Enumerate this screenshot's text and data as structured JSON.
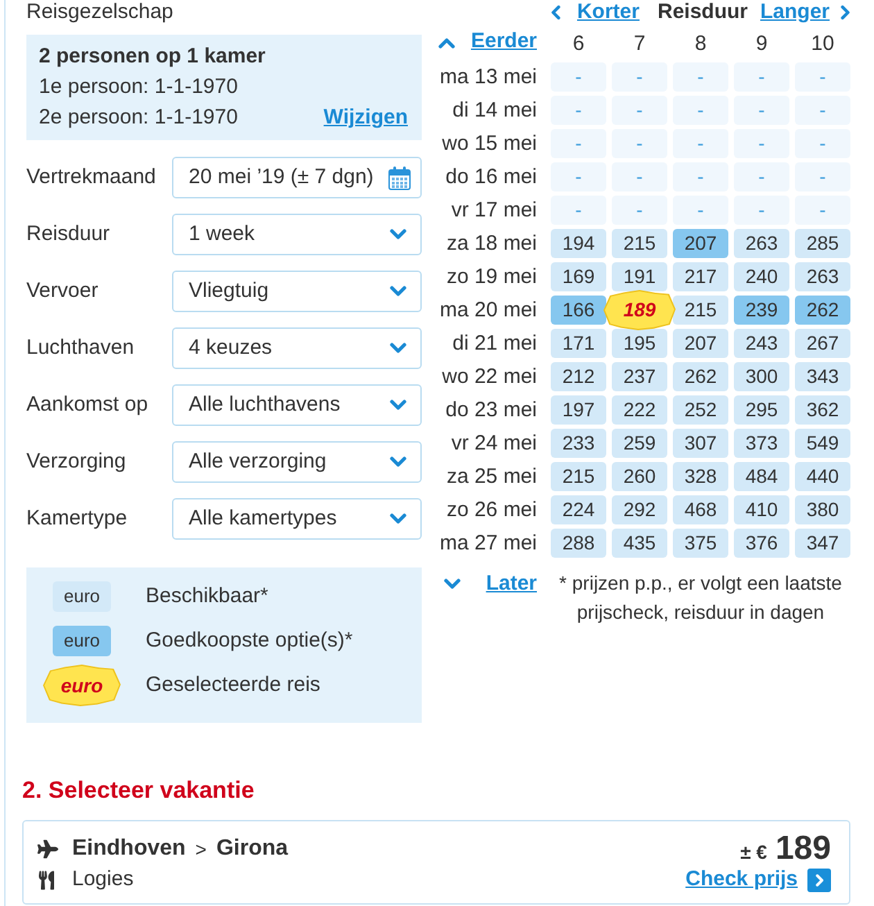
{
  "travel_party": {
    "label": "Reisgezelschap",
    "summary": "2 personen op 1 kamer",
    "persons": [
      "1e persoon: 1-1-1970",
      "2e persoon: 1-1-1970"
    ],
    "change_link": "Wijzigen"
  },
  "fields": [
    {
      "label": "Vertrekmaand",
      "value": "20 mei ’19 (± 7 dgn)",
      "kind": "date"
    },
    {
      "label": "Reisduur",
      "value": "1 week",
      "kind": "select"
    },
    {
      "label": "Vervoer",
      "value": "Vliegtuig",
      "kind": "select"
    },
    {
      "label": "Luchthaven",
      "value": "4 keuzes",
      "kind": "select"
    },
    {
      "label": "Aankomst op",
      "value": "Alle luchthavens",
      "kind": "select"
    },
    {
      "label": "Verzorging",
      "value": "Alle verzorging",
      "kind": "select"
    },
    {
      "label": "Kamertype",
      "value": "Alle kamertypes",
      "kind": "select"
    }
  ],
  "legend": [
    {
      "sample": "euro",
      "label": "Beschikbaar*",
      "kind": "available"
    },
    {
      "sample": "euro",
      "label": "Goedkoopste optie(s)*",
      "kind": "cheapest"
    },
    {
      "sample": "euro",
      "label": "Geselecteerde reis",
      "kind": "selected"
    }
  ],
  "duration_nav": {
    "shorter": "Korter",
    "title": "Reisduur",
    "longer": "Langer"
  },
  "price_grid": {
    "earlier": "Eerder",
    "columns": [
      "6",
      "7",
      "8",
      "9",
      "10"
    ],
    "rows": [
      {
        "date": "ma 13 mei",
        "cells": [
          {
            "price": "-",
            "kind": "empty",
            "selected": false
          },
          {
            "price": "-",
            "kind": "empty",
            "selected": false
          },
          {
            "price": "-",
            "kind": "empty",
            "selected": false
          },
          {
            "price": "-",
            "kind": "empty",
            "selected": false
          },
          {
            "price": "-",
            "kind": "empty",
            "selected": false
          }
        ]
      },
      {
        "date": "di 14 mei",
        "cells": [
          {
            "price": "-",
            "kind": "empty",
            "selected": false
          },
          {
            "price": "-",
            "kind": "empty",
            "selected": false
          },
          {
            "price": "-",
            "kind": "empty",
            "selected": false
          },
          {
            "price": "-",
            "kind": "empty",
            "selected": false
          },
          {
            "price": "-",
            "kind": "empty",
            "selected": false
          }
        ]
      },
      {
        "date": "wo 15 mei",
        "cells": [
          {
            "price": "-",
            "kind": "empty",
            "selected": false
          },
          {
            "price": "-",
            "kind": "empty",
            "selected": false
          },
          {
            "price": "-",
            "kind": "empty",
            "selected": false
          },
          {
            "price": "-",
            "kind": "empty",
            "selected": false
          },
          {
            "price": "-",
            "kind": "empty",
            "selected": false
          }
        ]
      },
      {
        "date": "do 16 mei",
        "cells": [
          {
            "price": "-",
            "kind": "empty",
            "selected": false
          },
          {
            "price": "-",
            "kind": "empty",
            "selected": false
          },
          {
            "price": "-",
            "kind": "empty",
            "selected": false
          },
          {
            "price": "-",
            "kind": "empty",
            "selected": false
          },
          {
            "price": "-",
            "kind": "empty",
            "selected": false
          }
        ]
      },
      {
        "date": "vr 17 mei",
        "cells": [
          {
            "price": "-",
            "kind": "empty",
            "selected": false
          },
          {
            "price": "-",
            "kind": "empty",
            "selected": false
          },
          {
            "price": "-",
            "kind": "empty",
            "selected": false
          },
          {
            "price": "-",
            "kind": "empty",
            "selected": false
          },
          {
            "price": "-",
            "kind": "empty",
            "selected": false
          }
        ]
      },
      {
        "date": "za 18 mei",
        "cells": [
          {
            "price": "194",
            "kind": "available",
            "selected": false
          },
          {
            "price": "215",
            "kind": "available",
            "selected": false
          },
          {
            "price": "207",
            "kind": "cheapest",
            "selected": false
          },
          {
            "price": "263",
            "kind": "available",
            "selected": false
          },
          {
            "price": "285",
            "kind": "available",
            "selected": false
          }
        ]
      },
      {
        "date": "zo 19 mei",
        "cells": [
          {
            "price": "169",
            "kind": "available",
            "selected": false
          },
          {
            "price": "191",
            "kind": "available",
            "selected": false
          },
          {
            "price": "217",
            "kind": "available",
            "selected": false
          },
          {
            "price": "240",
            "kind": "available",
            "selected": false
          },
          {
            "price": "263",
            "kind": "available",
            "selected": false
          }
        ]
      },
      {
        "date": "ma 20 mei",
        "cells": [
          {
            "price": "166",
            "kind": "cheapest",
            "selected": false
          },
          {
            "price": "189",
            "selected": true
          },
          {
            "price": "215",
            "kind": "available",
            "selected": false
          },
          {
            "price": "239",
            "kind": "cheapest",
            "selected": false
          },
          {
            "price": "262",
            "kind": "cheapest",
            "selected": false
          }
        ]
      },
      {
        "date": "di 21 mei",
        "cells": [
          {
            "price": "171",
            "kind": "available",
            "selected": false
          },
          {
            "price": "195",
            "kind": "available",
            "selected": false
          },
          {
            "price": "207",
            "kind": "available",
            "selected": false
          },
          {
            "price": "243",
            "kind": "available",
            "selected": false
          },
          {
            "price": "267",
            "kind": "available",
            "selected": false
          }
        ]
      },
      {
        "date": "wo 22 mei",
        "cells": [
          {
            "price": "212",
            "kind": "available",
            "selected": false
          },
          {
            "price": "237",
            "kind": "available",
            "selected": false
          },
          {
            "price": "262",
            "kind": "available",
            "selected": false
          },
          {
            "price": "300",
            "kind": "available",
            "selected": false
          },
          {
            "price": "343",
            "kind": "available",
            "selected": false
          }
        ]
      },
      {
        "date": "do 23 mei",
        "cells": [
          {
            "price": "197",
            "kind": "available",
            "selected": false
          },
          {
            "price": "222",
            "kind": "available",
            "selected": false
          },
          {
            "price": "252",
            "kind": "available",
            "selected": false
          },
          {
            "price": "295",
            "kind": "available",
            "selected": false
          },
          {
            "price": "362",
            "kind": "available",
            "selected": false
          }
        ]
      },
      {
        "date": "vr 24 mei",
        "cells": [
          {
            "price": "233",
            "kind": "available",
            "selected": false
          },
          {
            "price": "259",
            "kind": "available",
            "selected": false
          },
          {
            "price": "307",
            "kind": "available",
            "selected": false
          },
          {
            "price": "373",
            "kind": "available",
            "selected": false
          },
          {
            "price": "549",
            "kind": "available",
            "selected": false
          }
        ]
      },
      {
        "date": "za 25 mei",
        "cells": [
          {
            "price": "215",
            "kind": "available",
            "selected": false
          },
          {
            "price": "260",
            "kind": "available",
            "selected": false
          },
          {
            "price": "328",
            "kind": "available",
            "selected": false
          },
          {
            "price": "484",
            "kind": "available",
            "selected": false
          },
          {
            "price": "440",
            "kind": "available",
            "selected": false
          }
        ]
      },
      {
        "date": "zo 26 mei",
        "cells": [
          {
            "price": "224",
            "kind": "available",
            "selected": false
          },
          {
            "price": "292",
            "kind": "available",
            "selected": false
          },
          {
            "price": "468",
            "kind": "available",
            "selected": false
          },
          {
            "price": "410",
            "kind": "available",
            "selected": false
          },
          {
            "price": "380",
            "kind": "available",
            "selected": false
          }
        ]
      },
      {
        "date": "ma 27 mei",
        "cells": [
          {
            "price": "288",
            "kind": "available",
            "selected": false
          },
          {
            "price": "435",
            "kind": "available",
            "selected": false
          },
          {
            "price": "375",
            "kind": "available",
            "selected": false
          },
          {
            "price": "376",
            "kind": "available",
            "selected": false
          },
          {
            "price": "347",
            "kind": "available",
            "selected": false
          }
        ]
      }
    ],
    "later": "Later",
    "footnote": "* prijzen p.p., er volgt een laatste prijscheck, reisduur in dagen"
  },
  "section_title": "2. Selecteer vakantie",
  "result": {
    "origin": "Eindhoven",
    "separator": ">",
    "destination": "Girona",
    "board": "Logies",
    "price_prefix": "± €",
    "price": "189",
    "check_link": "Check prijs"
  }
}
